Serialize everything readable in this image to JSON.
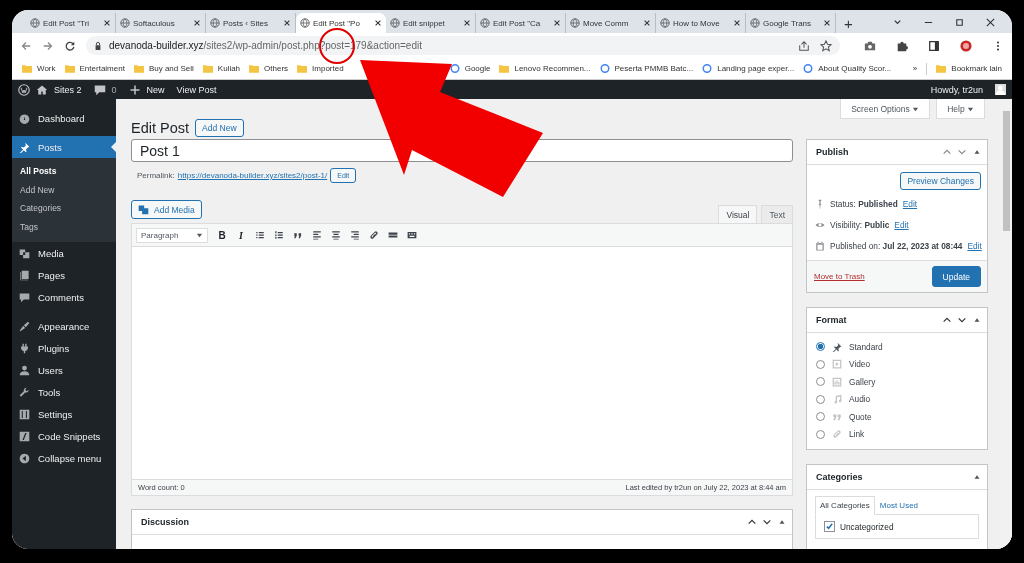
{
  "browser": {
    "tabs": [
      {
        "title": "Edit Post \"Tri",
        "selected": false
      },
      {
        "title": "Softaculous",
        "selected": false
      },
      {
        "title": "Posts ‹ Sites",
        "selected": false
      },
      {
        "title": "Edit Post \"Po",
        "selected": true
      },
      {
        "title": "Edit snippet",
        "selected": false
      },
      {
        "title": "Edit Post \"Ca",
        "selected": false
      },
      {
        "title": "Move Comm",
        "selected": false
      },
      {
        "title": "How to Move",
        "selected": false
      },
      {
        "title": "Google Trans",
        "selected": false
      }
    ],
    "new_tab": "+",
    "host": "devanoda-builder.xyz",
    "path": "/sites2/wp-admin/post.php?post=179&action=edit",
    "bookmarks": [
      {
        "label": "Work",
        "kind": "folder"
      },
      {
        "label": "Entertaiment",
        "kind": "folder"
      },
      {
        "label": "Buy and Sell",
        "kind": "folder"
      },
      {
        "label": "Kuliah",
        "kind": "folder"
      },
      {
        "label": "Others",
        "kind": "folder"
      },
      {
        "label": "Imported",
        "kind": "folder"
      },
      {
        "label": "Google",
        "kind": "page"
      },
      {
        "label": "Lenovo Recommen...",
        "kind": "folder"
      },
      {
        "label": "Peserta PMMB Batc...",
        "kind": "page"
      },
      {
        "label": "Landing page exper...",
        "kind": "page"
      },
      {
        "label": "About Quality Scor...",
        "kind": "page"
      }
    ],
    "more": "»",
    "other_bookmarks": "Bookmark lain"
  },
  "admin_bar": {
    "site": "Sites 2",
    "comments": "0",
    "new": "New",
    "view": "View Post",
    "greeting": "Howdy, tr2un"
  },
  "menu_groups": [
    {
      "items": [
        {
          "label": "Dashboard",
          "selected": false
        }
      ]
    },
    {
      "items": [
        {
          "label": "Posts",
          "selected": true,
          "children": [
            {
              "label": "All Posts",
              "selected": true
            },
            {
              "label": "Add New",
              "selected": false
            },
            {
              "label": "Categories",
              "selected": false
            },
            {
              "label": "Tags",
              "selected": false
            }
          ]
        },
        {
          "label": "Media",
          "selected": false
        },
        {
          "label": "Pages",
          "selected": false
        },
        {
          "label": "Comments",
          "selected": false
        }
      ]
    },
    {
      "items": [
        {
          "label": "Appearance",
          "selected": false
        },
        {
          "label": "Plugins",
          "selected": false
        },
        {
          "label": "Users",
          "selected": false
        },
        {
          "label": "Tools",
          "selected": false
        },
        {
          "label": "Settings",
          "selected": false
        },
        {
          "label": "Code Snippets",
          "selected": false
        },
        {
          "label": "Collapse menu",
          "selected": false
        }
      ]
    }
  ],
  "screen_options": [
    "Screen Options",
    "Help"
  ],
  "heading": "Edit Post",
  "add_new": "Add New",
  "title_value": "Post 1",
  "permalink": {
    "label": "Permalink:",
    "url": "https://devanoda-builder.xyz/sites2/post-1/",
    "button": "Edit"
  },
  "add_media": "Add Media",
  "editor_tabs": [
    {
      "label": "Visual",
      "selected": true
    },
    {
      "label": "Text",
      "selected": false
    }
  ],
  "format_select": "Paragraph",
  "toolbar_letters": [
    "B",
    "I"
  ],
  "word_count": "Word count: 0",
  "last_edited": "Last edited by tr2un on July 22, 2023 at 8:44 am",
  "discussion": {
    "title": "Discussion"
  },
  "publish": {
    "title": "Publish",
    "preview": "Preview Changes",
    "rows": [
      {
        "label": "Status:",
        "value": "Published",
        "link": "Edit"
      },
      {
        "label": "Visibility:",
        "value": "Public",
        "link": "Edit"
      },
      {
        "label": "Published on:",
        "value": "Jul 22, 2023 at 08:44",
        "link": "Edit"
      }
    ],
    "trash": "Move to Trash",
    "update": "Update"
  },
  "format": {
    "title": "Format",
    "options": [
      {
        "label": "Standard",
        "selected": true
      },
      {
        "label": "Video",
        "selected": false
      },
      {
        "label": "Gallery",
        "selected": false
      },
      {
        "label": "Audio",
        "selected": false
      },
      {
        "label": "Quote",
        "selected": false
      },
      {
        "label": "Link",
        "selected": false
      }
    ]
  },
  "categories": {
    "title": "Categories",
    "tabs": [
      {
        "label": "All Categories",
        "selected": true
      },
      {
        "label": "Most Used",
        "selected": false
      }
    ],
    "items": [
      {
        "label": "Uncategorized",
        "checked": true
      }
    ]
  }
}
